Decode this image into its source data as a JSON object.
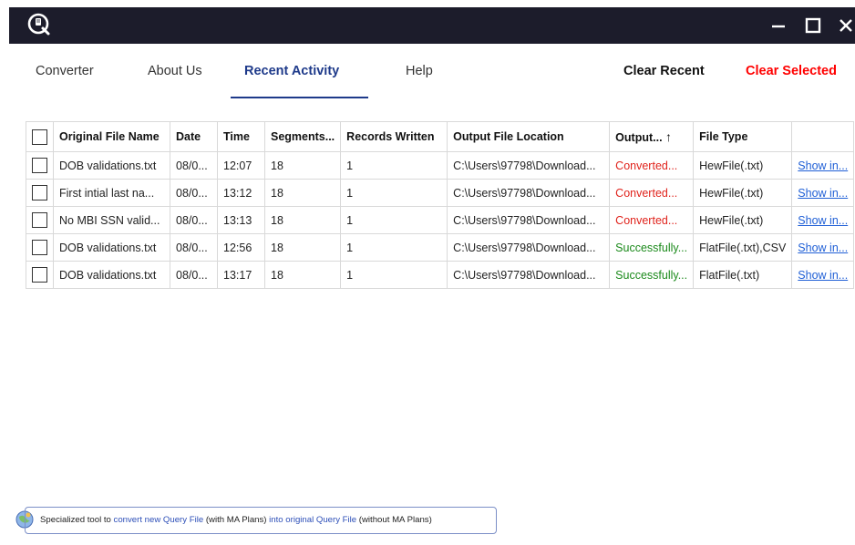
{
  "window": {
    "controls": {
      "minimize": "–",
      "maximize": "☐",
      "close": "✕"
    }
  },
  "nav": {
    "tabs": [
      {
        "label": "Converter"
      },
      {
        "label": "About Us"
      },
      {
        "label": "Recent Activity",
        "active": true
      },
      {
        "label": "Help"
      }
    ],
    "clear_recent": "Clear Recent",
    "clear_selected": "Clear Selected"
  },
  "table": {
    "columns": [
      "Original File Name",
      "Date",
      "Time",
      "Segments...",
      "Records Written",
      "Output File Location",
      "Output...",
      "File Type",
      ""
    ],
    "sort_indicator": "↑",
    "rows": [
      {
        "name": "DOB validations.txt",
        "date": "08/0...",
        "time": "12:07",
        "segments": "18",
        "records": "1",
        "location": "C:\\Users\\97798\\Download...",
        "output": "Converted...",
        "status": "red",
        "type": "HewFile(.txt)",
        "action": "Show in..."
      },
      {
        "name": "First intial last na...",
        "date": "08/0...",
        "time": "13:12",
        "segments": "18",
        "records": "1",
        "location": "C:\\Users\\97798\\Download...",
        "output": "Converted...",
        "status": "red",
        "type": "HewFile(.txt)",
        "action": "Show in..."
      },
      {
        "name": "No MBI SSN valid...",
        "date": "08/0...",
        "time": "13:13",
        "segments": "18",
        "records": "1",
        "location": "C:\\Users\\97798\\Download...",
        "output": "Converted...",
        "status": "red",
        "type": "HewFile(.txt)",
        "action": "Show in..."
      },
      {
        "name": "DOB validations.txt",
        "date": "08/0...",
        "time": "12:56",
        "segments": "18",
        "records": "1",
        "location": "C:\\Users\\97798\\Download...",
        "output": "Successfully...",
        "status": "green",
        "type": "FlatFile(.txt),CSV",
        "action": "Show in..."
      },
      {
        "name": "DOB validations.txt",
        "date": "08/0...",
        "time": "13:17",
        "segments": "18",
        "records": "1",
        "location": "C:\\Users\\97798\\Download...",
        "output": "Successfully...",
        "status": "green",
        "type": "FlatFile(.txt)",
        "action": "Show in..."
      }
    ]
  },
  "footer": {
    "part1": "Specialized tool to ",
    "part2": "convert new Query File",
    "part3": " (with MA Plans) ",
    "part4": "into original Query File",
    "part5": " (without MA Plans)"
  },
  "colors": {
    "titlebar": "#1c1c2b",
    "accent": "#1e3a8a",
    "danger": "#ff0000",
    "success": "#1b8a1b",
    "link": "#1f5fd6"
  },
  "icons": [
    "app-logo-icon",
    "minimize-icon",
    "maximize-icon",
    "close-icon",
    "sort-up-icon",
    "globe-icon"
  ]
}
